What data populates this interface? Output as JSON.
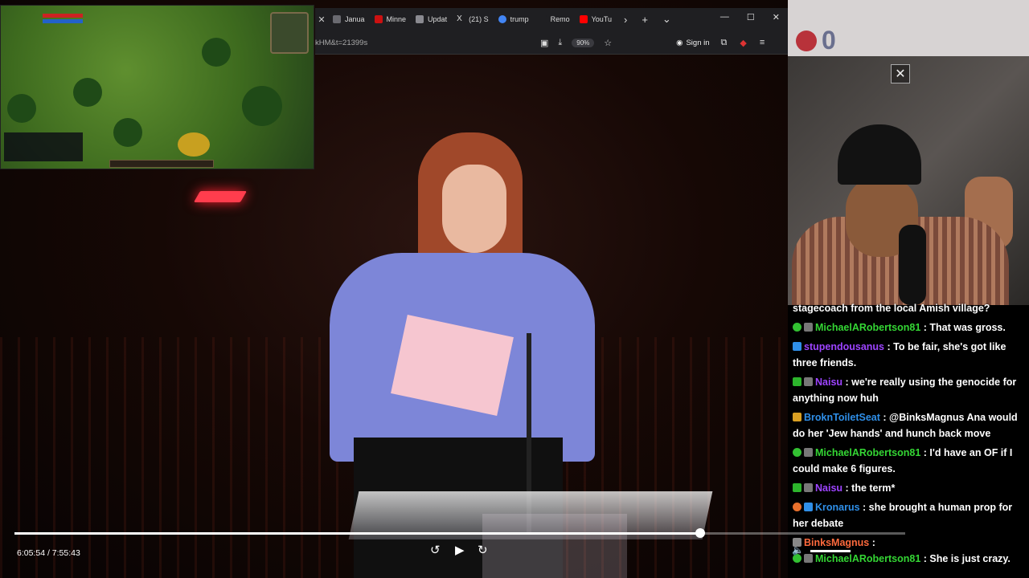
{
  "browser": {
    "tabs": [
      {
        "label": "Janua",
        "icon": "doc-icon",
        "color": "#6a6a70"
      },
      {
        "label": "Minne",
        "icon": "cnn-icon",
        "color": "#cc1111"
      },
      {
        "label": "Updat",
        "icon": "update-icon",
        "color": "#8a8a90"
      },
      {
        "label": "(21) S",
        "icon": "x-icon",
        "color": "#dddddd"
      },
      {
        "label": "trump",
        "icon": "google-icon",
        "color": "#4285f4"
      },
      {
        "label": "Remo",
        "icon": "blank-icon",
        "color": "#1f1f22"
      },
      {
        "label": "YouTu",
        "icon": "youtube-icon",
        "color": "#ff0000"
      }
    ],
    "url": "kHM&t=21399s",
    "zoom": "90%",
    "signin_label": "Sign in"
  },
  "webcam": {
    "counter": "0"
  },
  "chat": {
    "messages": [
      {
        "user": "",
        "text": "stagecoach from the local Amish village?",
        "color": "#ffffff",
        "badges": []
      },
      {
        "user": "MichaelARobertson81",
        "text": " : That was gross.",
        "color": "#34d634",
        "badges": [
          "green",
          "hide"
        ]
      },
      {
        "user": "stupendousanus",
        "text": " : To be fair, she's got like three friends.",
        "color": "#9d44ff",
        "badges": [
          "blue"
        ]
      },
      {
        "user": "Naisu",
        "text": " : we're really using the genocide for anything now huh",
        "color": "#9d44ff",
        "badges": [
          "check",
          "hide"
        ]
      },
      {
        "user": "BroknToiletSeat",
        "text": " : @BinksMagnus Ana would do her 'Jew hands' and hunch back move",
        "color": "#2f8fe8",
        "badges": [
          "gold"
        ]
      },
      {
        "user": "MichaelARobertson81",
        "text": " : I'd have an OF if I could make 6 figures.",
        "color": "#34d634",
        "badges": [
          "green",
          "hide"
        ]
      },
      {
        "user": "Naisu",
        "text": " : the term*",
        "color": "#9d44ff",
        "badges": [
          "check",
          "hide"
        ]
      },
      {
        "user": "Kronarus",
        "text": " : she brought a human prop for her debate",
        "color": "#2f8fe8",
        "badges": [
          "orange",
          "blue"
        ]
      },
      {
        "user": "BinksMagnus",
        "text": " :",
        "color": "#ff6a3d",
        "badges": [
          "sound"
        ]
      },
      {
        "user": "MichaelARobertson81",
        "text": " : She is just crazy.",
        "color": "#34d634",
        "badges": [
          "green",
          "hide"
        ]
      }
    ]
  },
  "player": {
    "time": "6:05:54 / 7:55:43",
    "progress": 0.77
  }
}
